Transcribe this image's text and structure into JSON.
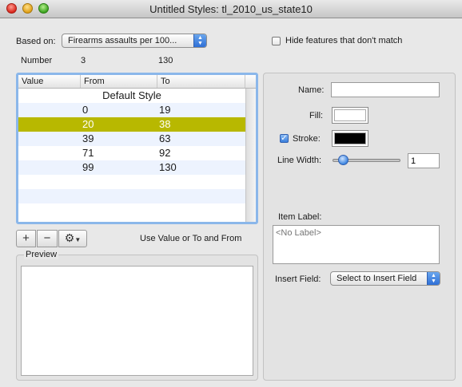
{
  "window": {
    "title": "Untitled Styles: tl_2010_us_state10"
  },
  "based_on": {
    "label": "Based on:",
    "value": "Firearms assaults per 100..."
  },
  "hide_features": {
    "label": "Hide features that don't match",
    "checked": false
  },
  "number_row": {
    "label": "Number",
    "min": "3",
    "max": "130"
  },
  "table": {
    "headers": [
      "Value",
      "From",
      "To"
    ],
    "default_row": "Default Style",
    "rows": [
      {
        "from": "0",
        "to": "19",
        "selected": false
      },
      {
        "from": "20",
        "to": "38",
        "selected": true
      },
      {
        "from": "39",
        "to": "63",
        "selected": false
      },
      {
        "from": "71",
        "to": "92",
        "selected": false
      },
      {
        "from": "99",
        "to": "130",
        "selected": false
      }
    ],
    "selected_color": "#b8b800"
  },
  "toolbar": {
    "add": "+",
    "remove": "−",
    "gear": "gear-icon",
    "hint": "Use Value or To and From"
  },
  "preview": {
    "label": "Preview"
  },
  "style_panel": {
    "name_label": "Name:",
    "name_value": "",
    "fill_label": "Fill:",
    "fill_color": "#ffffff",
    "stroke_label": "Stroke:",
    "stroke_checked": true,
    "stroke_color": "#000000",
    "line_width_label": "Line Width:",
    "line_width_value": "1",
    "item_label_label": "Item Label:",
    "item_label_placeholder": "<No Label>",
    "insert_field_label": "Insert Field:",
    "insert_field_value": "Select to Insert Field"
  }
}
